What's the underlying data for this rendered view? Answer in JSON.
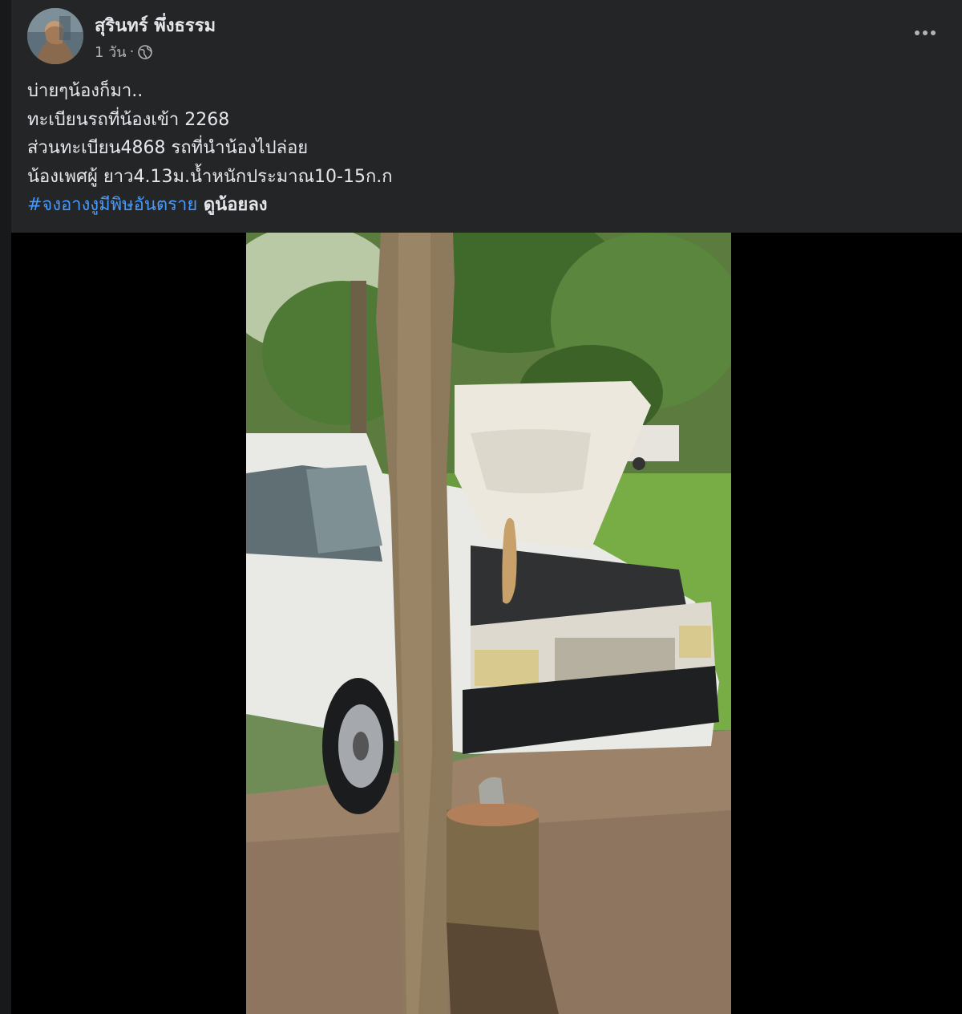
{
  "post": {
    "author": "สุรินทร์ พึ่งธรรม",
    "timestamp": "1 วัน",
    "separator": "·",
    "privacy_icon": "globe-icon",
    "more_icon": "more-options-icon",
    "caption_lines": [
      "บ่ายๆน้องก็มา..",
      "ทะเบียนรถที่น้องเข้า 2268",
      "ส่วนทะเบียน4868 รถที่นำน้องไปล่อย",
      "น้องเพศผู้ ยาว4.13ม.น้ำหนักประมาณ10-15ก.ก"
    ],
    "hashtag": "#จงอางงูมีพิษอันตราย",
    "hashtag_suffix": " ดูน้อยลง",
    "colors": {
      "background": "#242526",
      "text": "#e4e6eb",
      "secondary_text": "#b0b3b8",
      "link": "#4599ff"
    }
  }
}
